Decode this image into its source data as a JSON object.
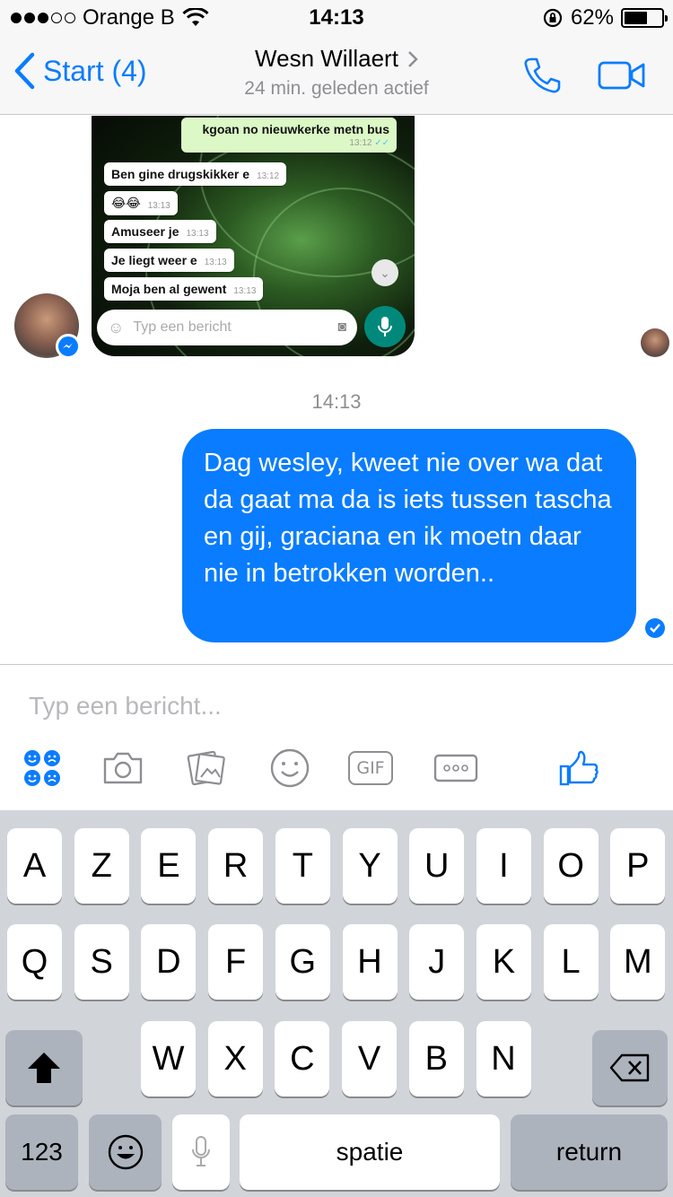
{
  "status_bar": {
    "carrier": "Orange B",
    "time": "14:13",
    "battery": "62%",
    "battery_level": 0.62
  },
  "nav": {
    "back_label": "Start (4)",
    "contact_name": "Wesn Willaert",
    "status": "24 min. geleden actief",
    "icons": [
      "phone-icon",
      "video-camera-icon"
    ]
  },
  "chat": {
    "screenshot": {
      "messages": [
        {
          "text": "kgoan no nieuwkerke metn bus",
          "time": "13:12",
          "direction": "out"
        },
        {
          "text": "Ben gine drugskikker e",
          "time": "13:12",
          "direction": "in"
        },
        {
          "text": "😂😂",
          "time": "13:13",
          "direction": "in"
        },
        {
          "text": "Amuseer je",
          "time": "13:13",
          "direction": "in"
        },
        {
          "text": "Je liegt weer e",
          "time": "13:13",
          "direction": "in"
        },
        {
          "text": "Moja ben al gewent",
          "time": "13:13",
          "direction": "in"
        }
      ],
      "input_placeholder": "Typ een bericht"
    },
    "time_separator": "14:13",
    "outgoing_message": "Dag wesley, kweet nie over wa dat da gaat ma da is iets tussen tascha en gij, graciana en ik moetn daar nie in betrokken worden.."
  },
  "composer": {
    "placeholder": "Typ een bericht...",
    "icons": [
      "emoji-grid-icon",
      "camera-icon",
      "gallery-icon",
      "smiley-icon",
      "gif-icon",
      "more-icon",
      "thumbs-up-icon"
    ],
    "gif_label": "GIF"
  },
  "keyboard": {
    "row1": [
      "A",
      "Z",
      "E",
      "R",
      "T",
      "Y",
      "U",
      "I",
      "O",
      "P"
    ],
    "row2": [
      "Q",
      "S",
      "D",
      "F",
      "G",
      "H",
      "J",
      "K",
      "L",
      "M"
    ],
    "row3": [
      "W",
      "X",
      "C",
      "V",
      "B",
      "N"
    ],
    "numbers_label": "123",
    "space_label": "spatie",
    "return_label": "return"
  },
  "colors": {
    "messenger_blue": "#0a7cff",
    "keyboard_bg": "#d1d4d9",
    "whatsapp_green": "#00897b"
  }
}
